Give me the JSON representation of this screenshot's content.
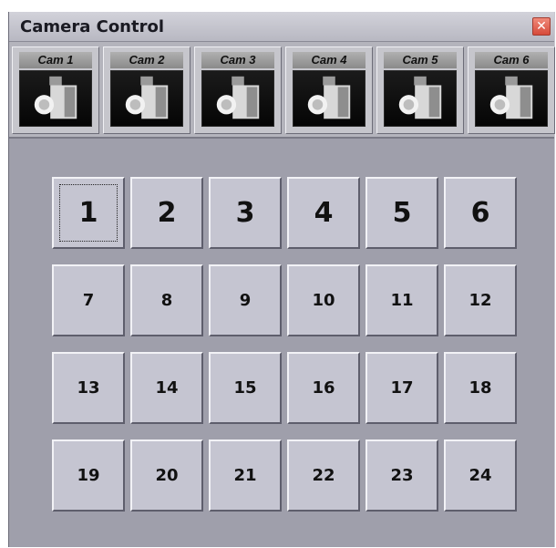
{
  "window": {
    "title": "Camera Control",
    "close_glyph": "✕"
  },
  "cameras": [
    {
      "label": "Cam 1",
      "icon": "camera-icon"
    },
    {
      "label": "Cam 2",
      "icon": "camera-icon"
    },
    {
      "label": "Cam 3",
      "icon": "camera-icon"
    },
    {
      "label": "Cam 4",
      "icon": "camera-icon"
    },
    {
      "label": "Cam 5",
      "icon": "camera-icon"
    },
    {
      "label": "Cam 6",
      "icon": "camera-icon"
    }
  ],
  "presets": {
    "focused": "1",
    "rows": [
      [
        "1",
        "2",
        "3",
        "4",
        "5",
        "6"
      ],
      [
        "7",
        "8",
        "9",
        "10",
        "11",
        "12"
      ],
      [
        "13",
        "14",
        "15",
        "16",
        "17",
        "18"
      ],
      [
        "19",
        "20",
        "21",
        "22",
        "23",
        "24"
      ]
    ]
  },
  "colors": {
    "window_bg": "#9f9fab",
    "button_face": "#c5c5d1",
    "close_button": "#d64a3a"
  }
}
